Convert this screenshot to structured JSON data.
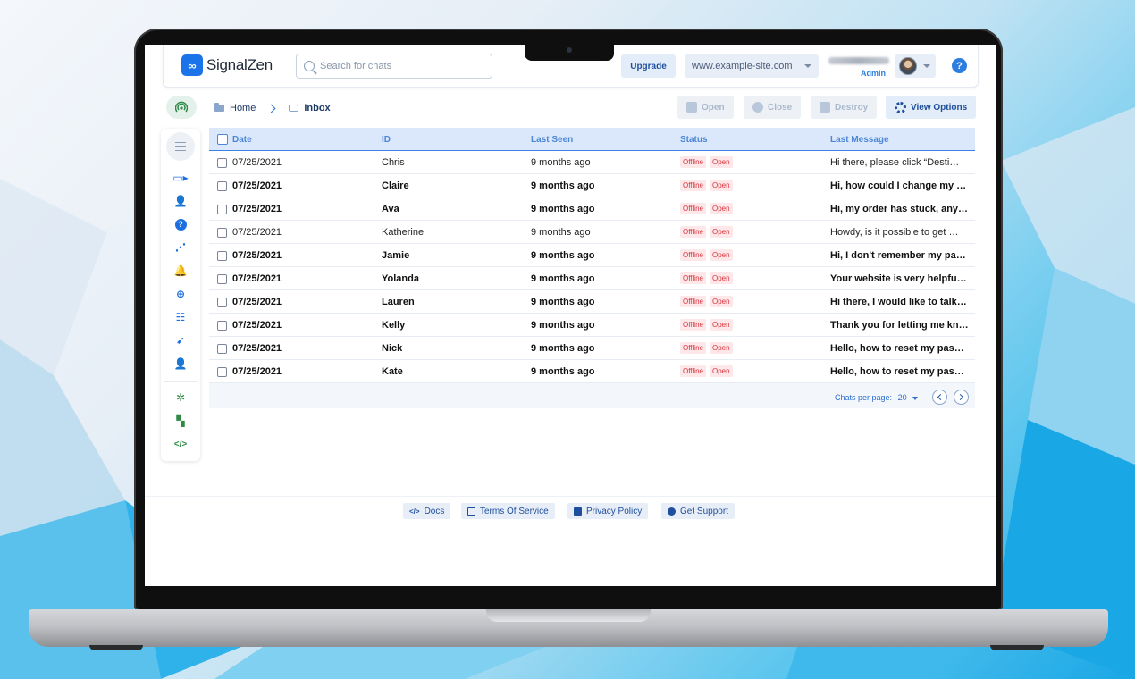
{
  "header": {
    "brand": "SignalZen",
    "search_placeholder": "Search for chats",
    "upgrade_label": "Upgrade",
    "site": "www.example-site.com",
    "user_role": "Admin",
    "help_label": "?"
  },
  "breadcrumb": {
    "home": "Home",
    "current": "Inbox"
  },
  "toolbar": {
    "open_label": "Open",
    "close_label": "Close",
    "destroy_label": "Destroy",
    "view_options_label": "View Options"
  },
  "table": {
    "columns": [
      "Date",
      "ID",
      "Last Seen",
      "Status",
      "Last Message"
    ],
    "rows": [
      {
        "date": "07/25/2021",
        "id": "Chris",
        "last_seen": "9 months ago",
        "status1": "Offline",
        "status2": "Open",
        "message": "Hi there, please click “Desti…",
        "bold": false
      },
      {
        "date": "07/25/2021",
        "id": "Claire",
        "last_seen": "9 months ago",
        "status1": "Offline",
        "status2": "Open",
        "message": "Hi, how could I change my …",
        "bold": true
      },
      {
        "date": "07/25/2021",
        "id": "Ava",
        "last_seen": "9 months ago",
        "status1": "Offline",
        "status2": "Open",
        "message": "Hi, my order has stuck, any…",
        "bold": true
      },
      {
        "date": "07/25/2021",
        "id": "Katherine",
        "last_seen": "9 months ago",
        "status1": "Offline",
        "status2": "Open",
        "message": "Howdy, is it possible to get …",
        "bold": false
      },
      {
        "date": "07/25/2021",
        "id": "Jamie",
        "last_seen": "9 months ago",
        "status1": "Offline",
        "status2": "Open",
        "message": "Hi, I don't remember my pa…",
        "bold": true
      },
      {
        "date": "07/25/2021",
        "id": "Yolanda",
        "last_seen": "9 months ago",
        "status1": "Offline",
        "status2": "Open",
        "message": "Your website is very helpfu…",
        "bold": true
      },
      {
        "date": "07/25/2021",
        "id": "Lauren",
        "last_seen": "9 months ago",
        "status1": "Offline",
        "status2": "Open",
        "message": "Hi there, I would like to talk…",
        "bold": true
      },
      {
        "date": "07/25/2021",
        "id": "Kelly",
        "last_seen": "9 months ago",
        "status1": "Offline",
        "status2": "Open",
        "message": "Thank you for letting me kn…",
        "bold": true
      },
      {
        "date": "07/25/2021",
        "id": "Nick",
        "last_seen": "9 months ago",
        "status1": "Offline",
        "status2": "Open",
        "message": "Hello, how to reset my pas…",
        "bold": true
      },
      {
        "date": "07/25/2021",
        "id": "Kate",
        "last_seen": "9 months ago",
        "status1": "Offline",
        "status2": "Open",
        "message": "Hello, how to reset my pas…",
        "bold": true
      }
    ],
    "per_page_label": "Chats per page:",
    "per_page_value": "20"
  },
  "footer": {
    "docs": "Docs",
    "terms": "Terms Of Service",
    "privacy": "Privacy Policy",
    "support": "Get Support"
  },
  "colors": {
    "accent": "#1d6fe0",
    "header_row": "#dbe8fb",
    "badge_red": "#d9343f",
    "green_icons": "#2f8a45"
  }
}
